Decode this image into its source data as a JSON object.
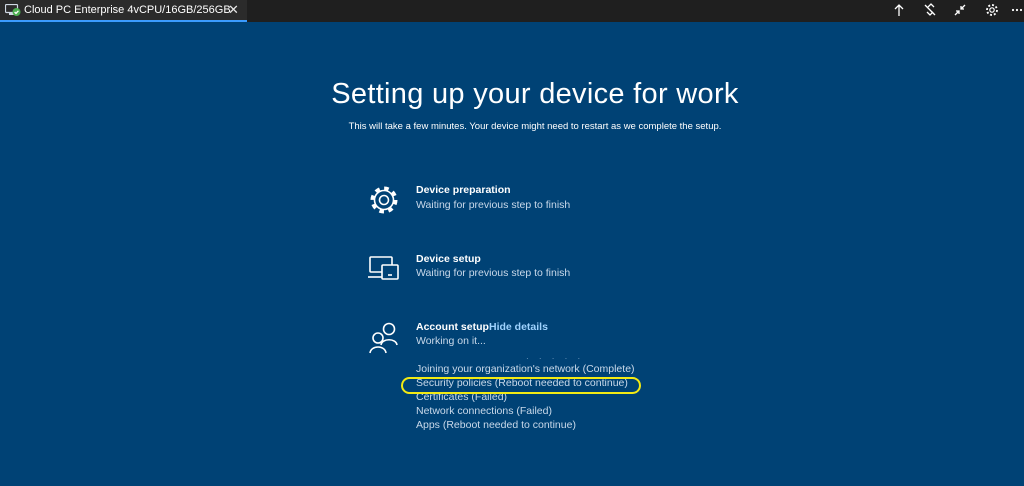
{
  "window": {
    "tab_title": "Cloud PC Enterprise 4vCPU/16GB/256GB",
    "close_glyph": "✕",
    "toolbar_icons": [
      "arrow-up-icon",
      "disconnect-icon",
      "collapse-icon",
      "gear-icon",
      "more-icon"
    ]
  },
  "main": {
    "title": "Setting up your device for work",
    "subtitle": "This will take a few minutes. Your device might need to restart as we complete the setup."
  },
  "steps": [
    {
      "icon": "gear-icon",
      "title": "Device preparation",
      "status": "Waiting for previous step to finish"
    },
    {
      "icon": "devices-icon",
      "title": "Device setup",
      "status": "Waiting for previous step to finish"
    },
    {
      "icon": "people-icon",
      "title": "Account setup",
      "status": "Working on it...",
      "link": "Hide details"
    }
  ],
  "progress_dots": "· · · · ·",
  "account_details": [
    "Joining your organization's network (Complete)",
    "Security policies (Reboot needed to continue)",
    "Certificates (Failed)",
    "Network connections (Failed)",
    "Apps (Reboot needed to continue)"
  ],
  "colors": {
    "background": "#004275",
    "highlight": "#f2ea14",
    "link": "#9fd3ff",
    "tab_accent": "#3b9cff"
  }
}
